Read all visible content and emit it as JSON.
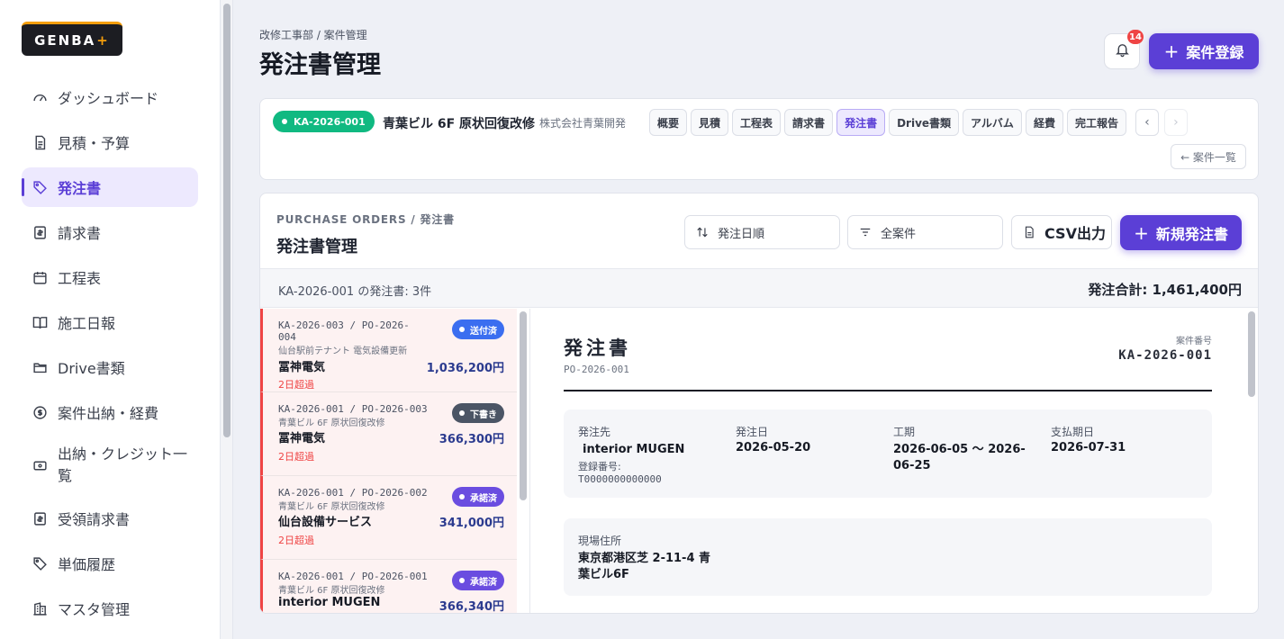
{
  "app": {
    "logo_text": "GENBA",
    "logo_plus": "+"
  },
  "sidebar": {
    "items": [
      {
        "label": "ダッシュボード",
        "icon": "gauge-icon"
      },
      {
        "label": "見積・予算",
        "icon": "document-icon"
      },
      {
        "label": "発注書",
        "icon": "tag-icon",
        "active": true
      },
      {
        "label": "請求書",
        "icon": "invoice-icon"
      },
      {
        "label": "工程表",
        "icon": "calendar-icon"
      },
      {
        "label": "施工日報",
        "icon": "book-icon"
      },
      {
        "label": "Drive書類",
        "icon": "folder-icon"
      },
      {
        "label": "案件出納・経費",
        "icon": "dollar-icon"
      },
      {
        "label": "出納・クレジット一覧",
        "icon": "card-icon"
      },
      {
        "label": "受領請求書",
        "icon": "receipt-icon"
      },
      {
        "label": "単価履歴",
        "icon": "tag-icon"
      },
      {
        "label": "マスタ管理",
        "icon": "building-icon"
      }
    ]
  },
  "header": {
    "breadcrumb": "改修工事部 / 案件管理",
    "title": "発注書管理",
    "notification_count": "14",
    "register_label": "案件登録"
  },
  "project": {
    "id": "KA-2026-001",
    "name": "青葉ビル 6F 原状回復改修",
    "client": "株式会社青葉開発",
    "tabs": [
      "概要",
      "見積",
      "工程表",
      "請求書",
      "発注書",
      "Drive書類",
      "アルバム",
      "経費",
      "完工報告"
    ],
    "active_tab": "発注書",
    "prev_arrow": "‹",
    "next_arrow": "›",
    "back_label": "← 案件一覧"
  },
  "po": {
    "subtitle": "PURCHASE ORDERS / 発注書",
    "title": "発注書管理",
    "sort_label": "発注日順",
    "filter_label": "全案件",
    "csv_label": "CSV出力",
    "new_label": "新規発注書",
    "summary_left": "KA-2026-001 の発注書: 3件",
    "summary_right": "発注合計: 1,461,400円",
    "items": [
      {
        "code": "KA-2026-003 / PO-2026-004",
        "desc": "仙台駅前テナント 電気設備更新",
        "vendor": "冨神電気",
        "amount": "1,036,200円",
        "overdue": "2日超過",
        "status": "送付済",
        "status_color": "#3b6ef0"
      },
      {
        "code": "KA-2026-001 / PO-2026-003",
        "desc": "青葉ビル 6F 原状回復改修",
        "vendor": "冨神電気",
        "amount": "366,300円",
        "overdue": "2日超過",
        "status": "下書き",
        "status_color": "#4b5565"
      },
      {
        "code": "KA-2026-001 / PO-2026-002",
        "desc": "青葉ビル 6F 原状回復改修",
        "vendor": "仙台設備サービス",
        "amount": "341,000円",
        "overdue": "2日超過",
        "status": "承諾済",
        "status_color": "#6a4de0"
      },
      {
        "code": "KA-2026-001 / PO-2026-001",
        "desc": "青葉ビル 6F 原状回復改修",
        "vendor": "interior MUGEN",
        "amount": "366,340円",
        "overdue": "",
        "status": "承諾済",
        "status_color": "#6a4de0"
      }
    ]
  },
  "doc": {
    "title": "発注書",
    "number": "PO-2026-001",
    "case_label": "案件番号",
    "case_no": "KA-2026-001",
    "supplier_label": "発注先",
    "supplier": "interior MUGEN",
    "reg_label": "登録番号:",
    "reg_no": "T0000000000000",
    "order_date_label": "発注日",
    "order_date": "2026-05-20",
    "period_label": "工期",
    "period": "2026-06-05 〜 2026-06-25",
    "due_label": "支払期日",
    "due": "2026-07-31",
    "site_label": "現場住所",
    "site": "東京都港区芝 2-11-4 青葉ビル6F"
  }
}
